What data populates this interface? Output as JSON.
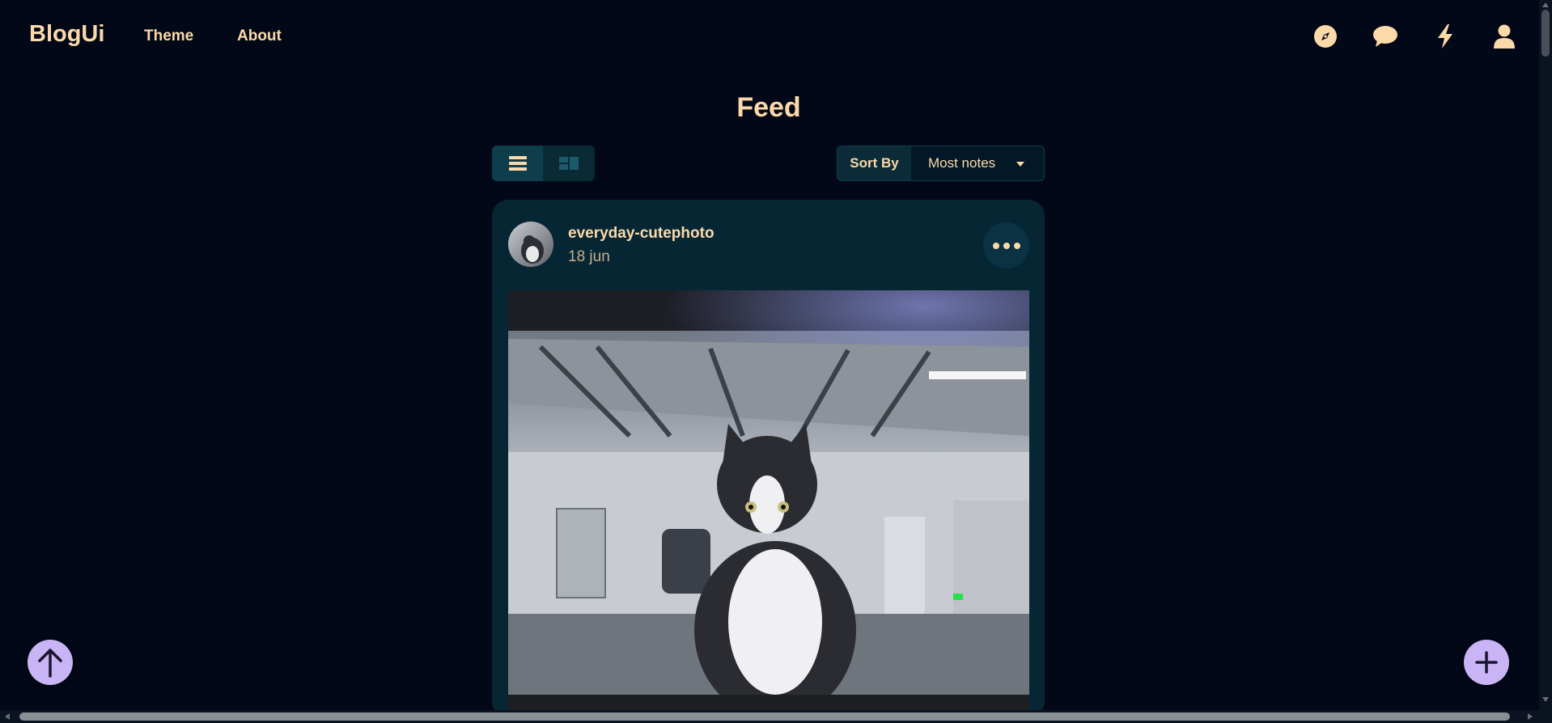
{
  "header": {
    "brand": "BlogUi",
    "nav": [
      {
        "label": "Theme"
      },
      {
        "label": "About"
      }
    ],
    "icons": [
      "compass-icon",
      "chat-icon",
      "lightning-icon",
      "user-icon"
    ]
  },
  "feed": {
    "title": "Feed",
    "view_modes": [
      "list-view-icon",
      "grid-view-icon"
    ],
    "active_view": "list",
    "sort": {
      "label": "Sort By",
      "selected": "Most notes"
    }
  },
  "post": {
    "username": "everyday-cutephoto",
    "date": "18 jun"
  },
  "colors": {
    "background": "#020817",
    "card": "#062634",
    "accent_text": "#fcd9a8",
    "fab": "#c9b4f5"
  }
}
